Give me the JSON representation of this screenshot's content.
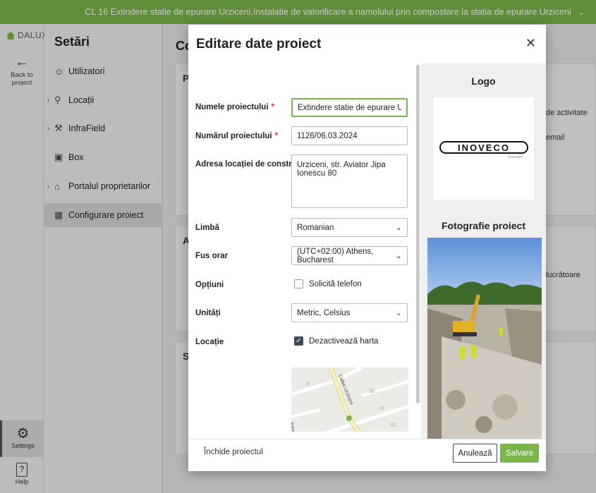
{
  "topbar": {
    "project_title": "CL 16 Extindere statie de epurare Urziceni.Instalatie de valorificare a namolului prin compostare la statia de epurare Urziceni",
    "chevron_icon": "chevron-down-icon"
  },
  "rail": {
    "logo_text": "DALUX",
    "back_label": "Back to project",
    "settings_label": "Settings",
    "help_label": "Help"
  },
  "nav": {
    "title": "Setări",
    "items": [
      {
        "label": "Utilizatori",
        "icon": "users-icon"
      },
      {
        "label": "Locații",
        "icon": "location-pin-icon"
      },
      {
        "label": "InfraField",
        "icon": "crane-icon"
      },
      {
        "label": "Box",
        "icon": "folder-icon"
      },
      {
        "label": "Portalul proprietarilor",
        "icon": "home-icon"
      },
      {
        "label": "Configurare proiect",
        "icon": "building-icon"
      }
    ]
  },
  "background": {
    "page_title_partial": "Co",
    "card1_letter": "P",
    "card2_letter": "A",
    "card3_letter": "S",
    "text_activitate": "de activitate",
    "text_email": "email",
    "text_lucratoare": "lucrătoare"
  },
  "modal": {
    "title": "Editare date proiect",
    "fields": {
      "project_name_label": "Numele proiectului",
      "project_name_value": "Extindere statie de epurare Urziceni.I",
      "project_number_label": "Numărul proiectului",
      "project_number_value": "1126/06.03.2024",
      "address_label": "Adresa locației de construcție",
      "address_value": "Urziceni, str. Aviator Jipa Ionescu 80",
      "language_label": "Limbă",
      "language_value": "Romanian",
      "timezone_label": "Fus orar",
      "timezone_value": "(UTC+02:00) Athens, Bucharest",
      "options_label": "Opțiuni",
      "options_checkbox": "Solicită telefon",
      "units_label": "Unități",
      "units_value": "Metric, Celsius",
      "location_label": "Locație",
      "location_checkbox": "Dezactivează harta",
      "required_mark": "*"
    },
    "map": {
      "street_label": "Calea Urziceni",
      "side_label": "lecha"
    },
    "right": {
      "logo_title": "Logo",
      "logo_text": "INOVECO",
      "logo_sub": "EXPERT",
      "photo_title": "Fotografie proiect"
    },
    "footer": {
      "close_project": "Închide proiectul",
      "cancel": "Anulează",
      "save": "Salvare"
    }
  },
  "colors": {
    "accent": "#7ab648",
    "required": "#e0243a",
    "checkbox_checked": "#3d4a58"
  }
}
